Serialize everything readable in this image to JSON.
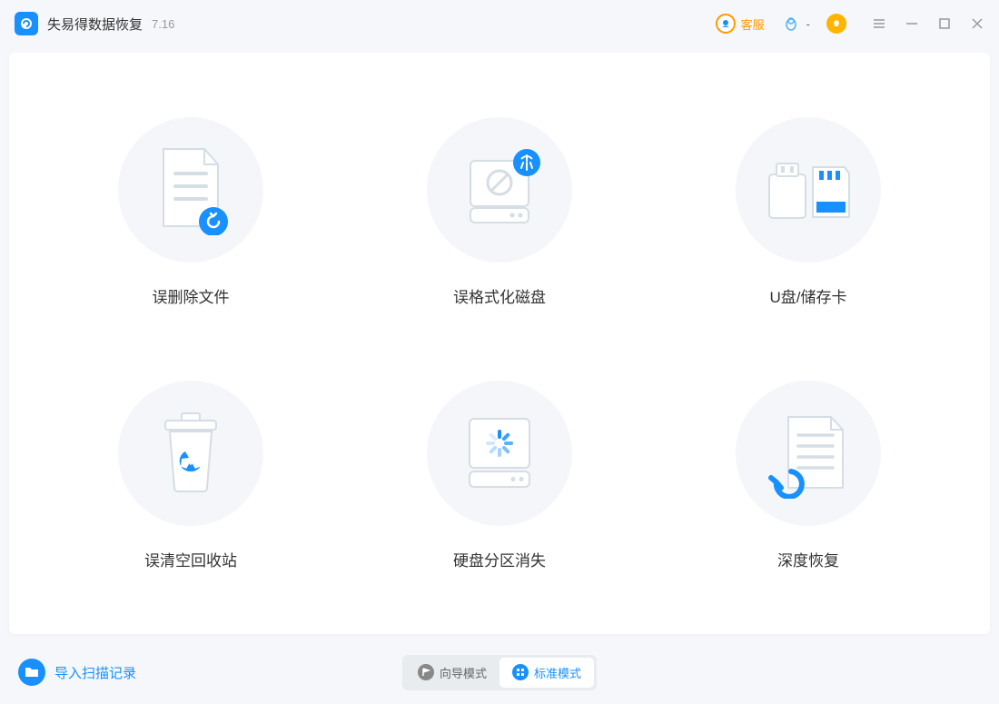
{
  "app": {
    "title": "失易得数据恢复",
    "version": "7.16"
  },
  "titlebar": {
    "customer_service": "客服",
    "qq_label": "-"
  },
  "tiles": [
    {
      "label": "误删除文件",
      "icon": "file-undo"
    },
    {
      "label": "误格式化磁盘",
      "icon": "disk-clean"
    },
    {
      "label": "U盘/储存卡",
      "icon": "usb-sdcard"
    },
    {
      "label": "误清空回收站",
      "icon": "recycle-bin"
    },
    {
      "label": "硬盘分区消失",
      "icon": "disk-loading"
    },
    {
      "label": "深度恢复",
      "icon": "deep-recover"
    }
  ],
  "footer": {
    "import_label": "导入扫描记录",
    "mode_guide": "向导模式",
    "mode_standard": "标准模式"
  }
}
